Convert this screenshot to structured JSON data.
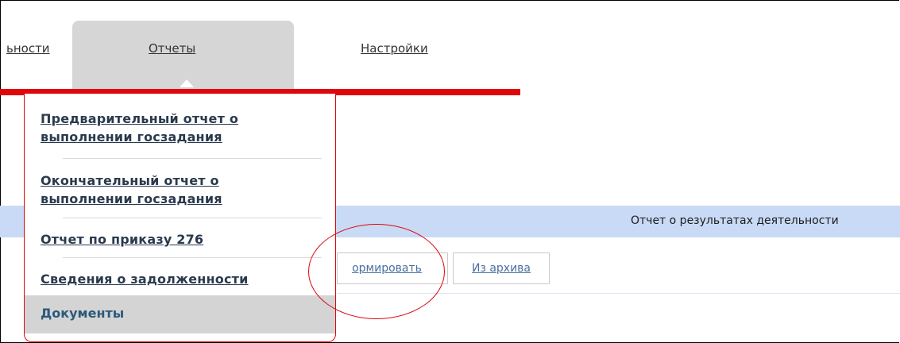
{
  "tabs": {
    "prev_label": "ьности",
    "active_label": "Отчеты",
    "next_label": "Настройки"
  },
  "dropdown": {
    "items": [
      {
        "label": "Предварительный отчет о выполнении госзадания"
      },
      {
        "label": "Окончательный отчет о выполнении госзадания"
      },
      {
        "label": "Отчет по приказу 276"
      },
      {
        "label": "Сведения о задолженности"
      }
    ],
    "selected_label": "Документы"
  },
  "content": {
    "strip_text": "Отчет о результатах деятельности",
    "generate_button": "ормировать",
    "archive_button": "Из архива"
  },
  "colors": {
    "accent_red": "#e0060a",
    "strip_blue": "#c9daf6",
    "active_tab_gray": "#d6d6d6"
  }
}
